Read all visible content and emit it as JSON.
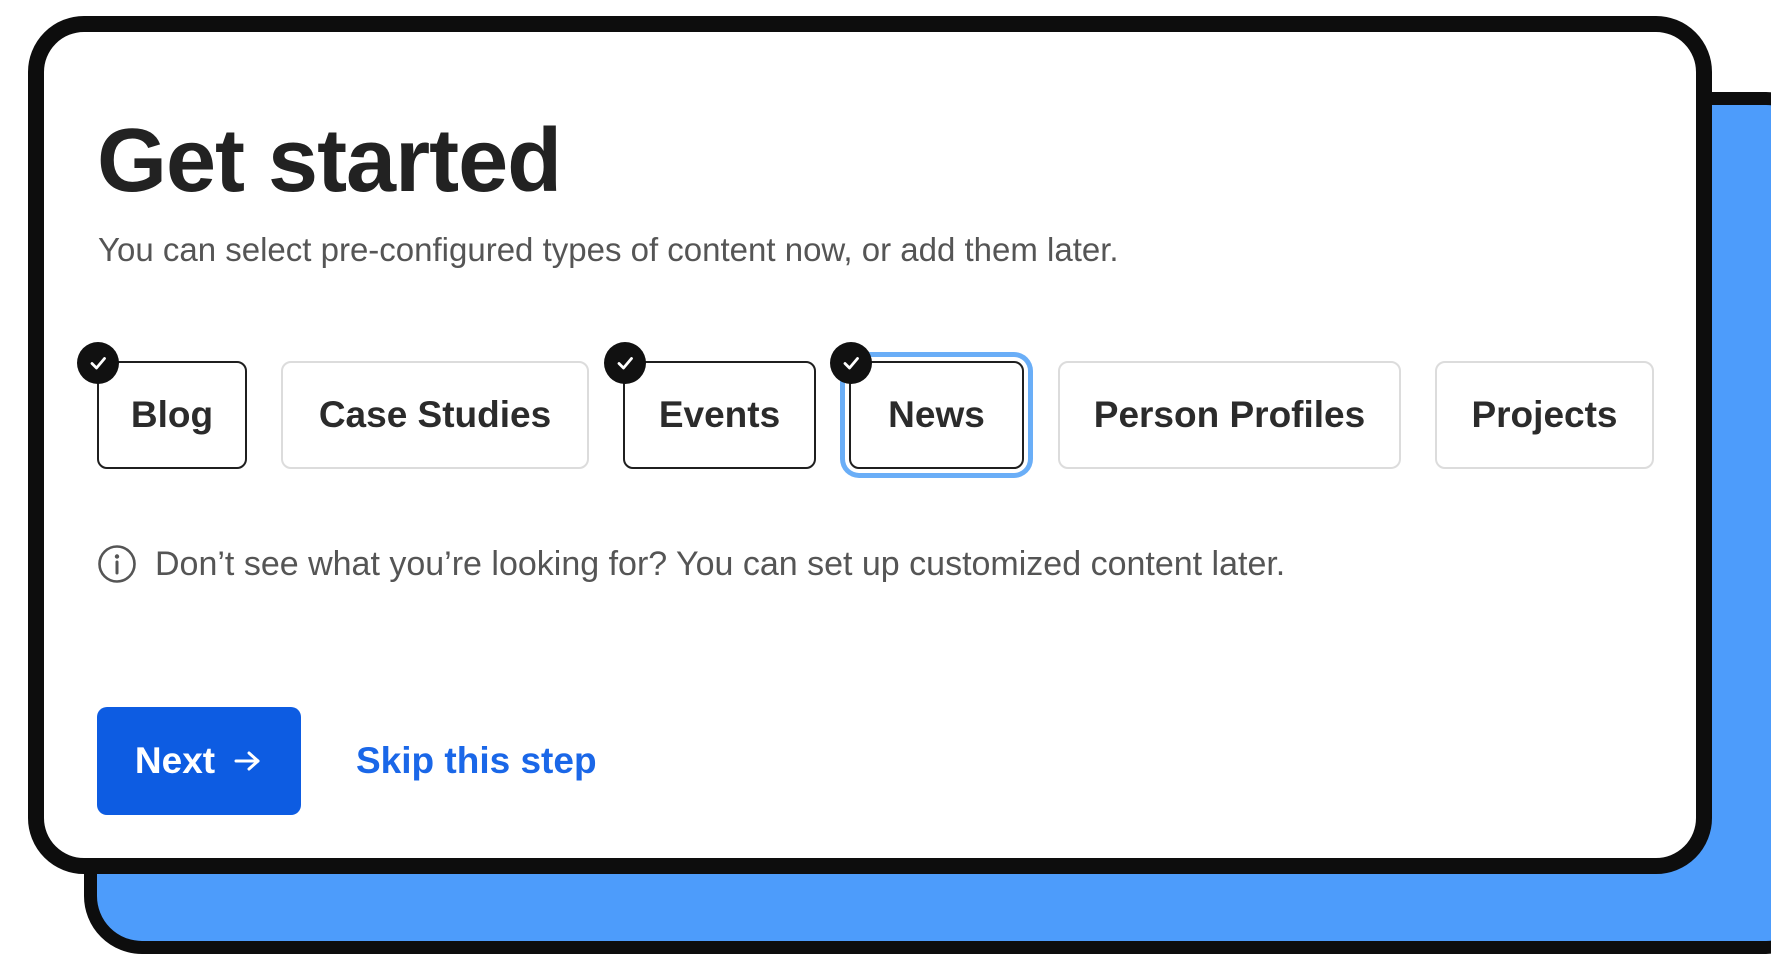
{
  "page": {
    "title": "Get started",
    "subtitle": "You can select pre-configured types of content now, or add them later."
  },
  "content_types": [
    {
      "label": "Blog",
      "selected": true
    },
    {
      "label": "Case Studies",
      "selected": false
    },
    {
      "label": "Events",
      "selected": true
    },
    {
      "label": "News",
      "selected": true,
      "focused": true
    },
    {
      "label": "Person Profiles",
      "selected": false
    },
    {
      "label": "Projects",
      "selected": false
    }
  ],
  "info": {
    "icon": "info-icon",
    "text": "Don’t see what you’re looking for? You can set up customized content later."
  },
  "actions": {
    "next_label": "Next",
    "next_icon": "arrow-right-icon",
    "skip_label": "Skip this step"
  },
  "colors": {
    "primary": "#0d5ce2",
    "link": "#1a67e8",
    "accent_back": "#4d9cfb",
    "focus_ring": "#6aaef7"
  }
}
